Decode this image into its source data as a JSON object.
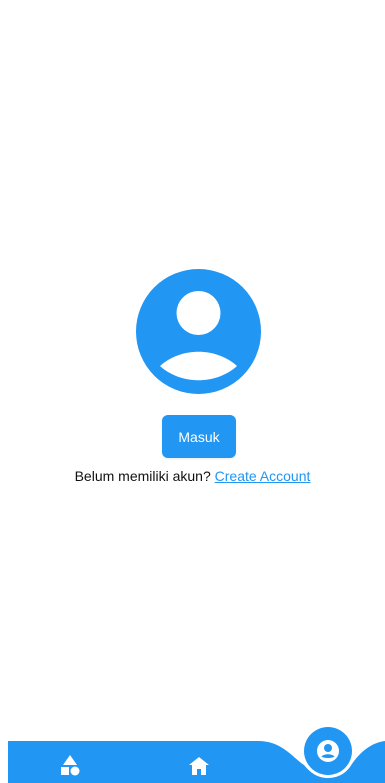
{
  "profile": {
    "avatar_icon": "person-icon",
    "login_button_label": "Masuk",
    "signup_prompt": "Belum memiliki akun?",
    "signup_link_label": "Create Account"
  },
  "bottom_nav": {
    "items": [
      {
        "icon": "shapes-icon",
        "active": false
      },
      {
        "icon": "home-icon",
        "active": false
      },
      {
        "icon": "account-circle-icon",
        "active": true
      }
    ]
  },
  "colors": {
    "accent": "#2196f3",
    "text": "#111111",
    "background": "#ffffff"
  }
}
